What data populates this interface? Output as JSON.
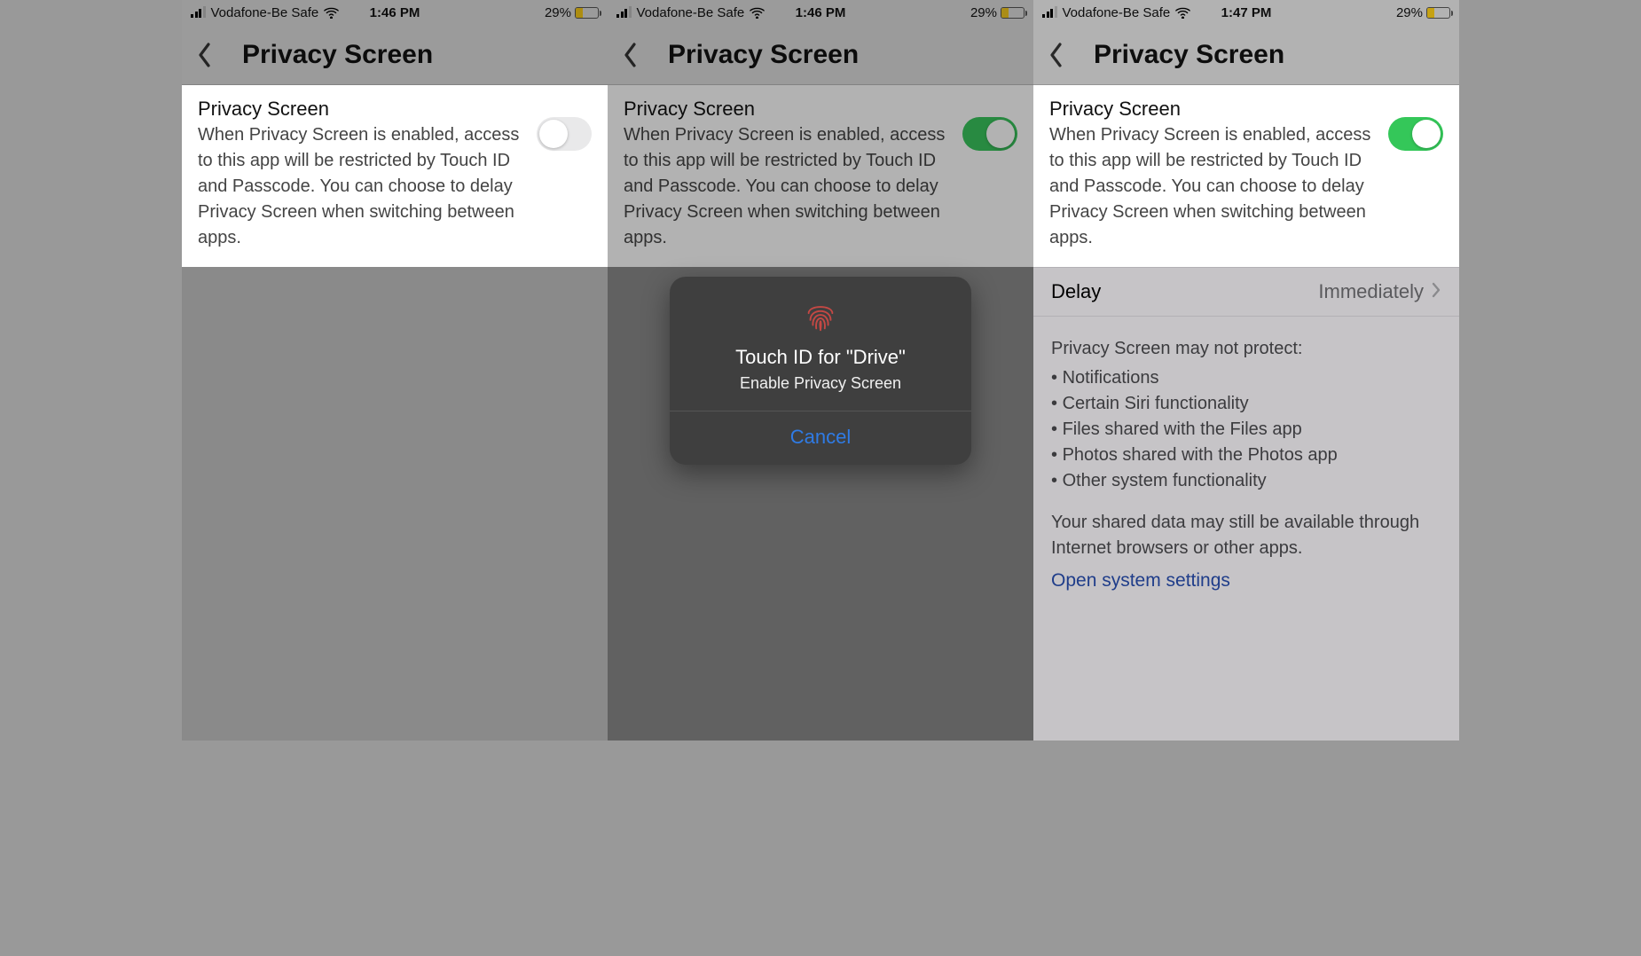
{
  "screens": [
    {
      "status": {
        "carrier": "Vodafone-Be Safe",
        "time": "1:46 PM",
        "battery_percent": "29%"
      },
      "nav_title": "Privacy Screen",
      "card": {
        "title": "Privacy Screen",
        "desc": "When Privacy Screen is enabled, access to this app will be restricted by Touch ID and Passcode. You can choose to delay Privacy Screen when switching between apps.",
        "toggle_on": false
      }
    },
    {
      "status": {
        "carrier": "Vodafone-Be Safe",
        "time": "1:46 PM",
        "battery_percent": "29%"
      },
      "nav_title": "Privacy Screen",
      "card": {
        "title": "Privacy Screen",
        "desc": "When Privacy Screen is enabled, access to this app will be restricted by Touch ID and Passcode. You can choose to delay Privacy Screen when switching between apps.",
        "toggle_on": true
      },
      "modal": {
        "title": "Touch ID for \"Drive\"",
        "subtitle": "Enable Privacy Screen",
        "cancel": "Cancel"
      }
    },
    {
      "status": {
        "carrier": "Vodafone-Be Safe",
        "time": "1:47 PM",
        "battery_percent": "29%"
      },
      "nav_title": "Privacy Screen",
      "card": {
        "title": "Privacy Screen",
        "desc": "When Privacy Screen is enabled, access to this app will be restricted by Touch ID and Passcode. You can choose to delay Privacy Screen when switching between apps.",
        "toggle_on": true
      },
      "delay": {
        "label": "Delay",
        "value": "Immediately"
      },
      "info": {
        "heading": "Privacy Screen may not protect:",
        "items": [
          "Notifications",
          "Certain Siri functionality",
          "Files shared with the Files app",
          "Photos shared with the Photos app",
          "Other system functionality"
        ],
        "footer": "Your shared data may still be available through Internet browsers or other apps."
      },
      "link": "Open system settings"
    }
  ]
}
